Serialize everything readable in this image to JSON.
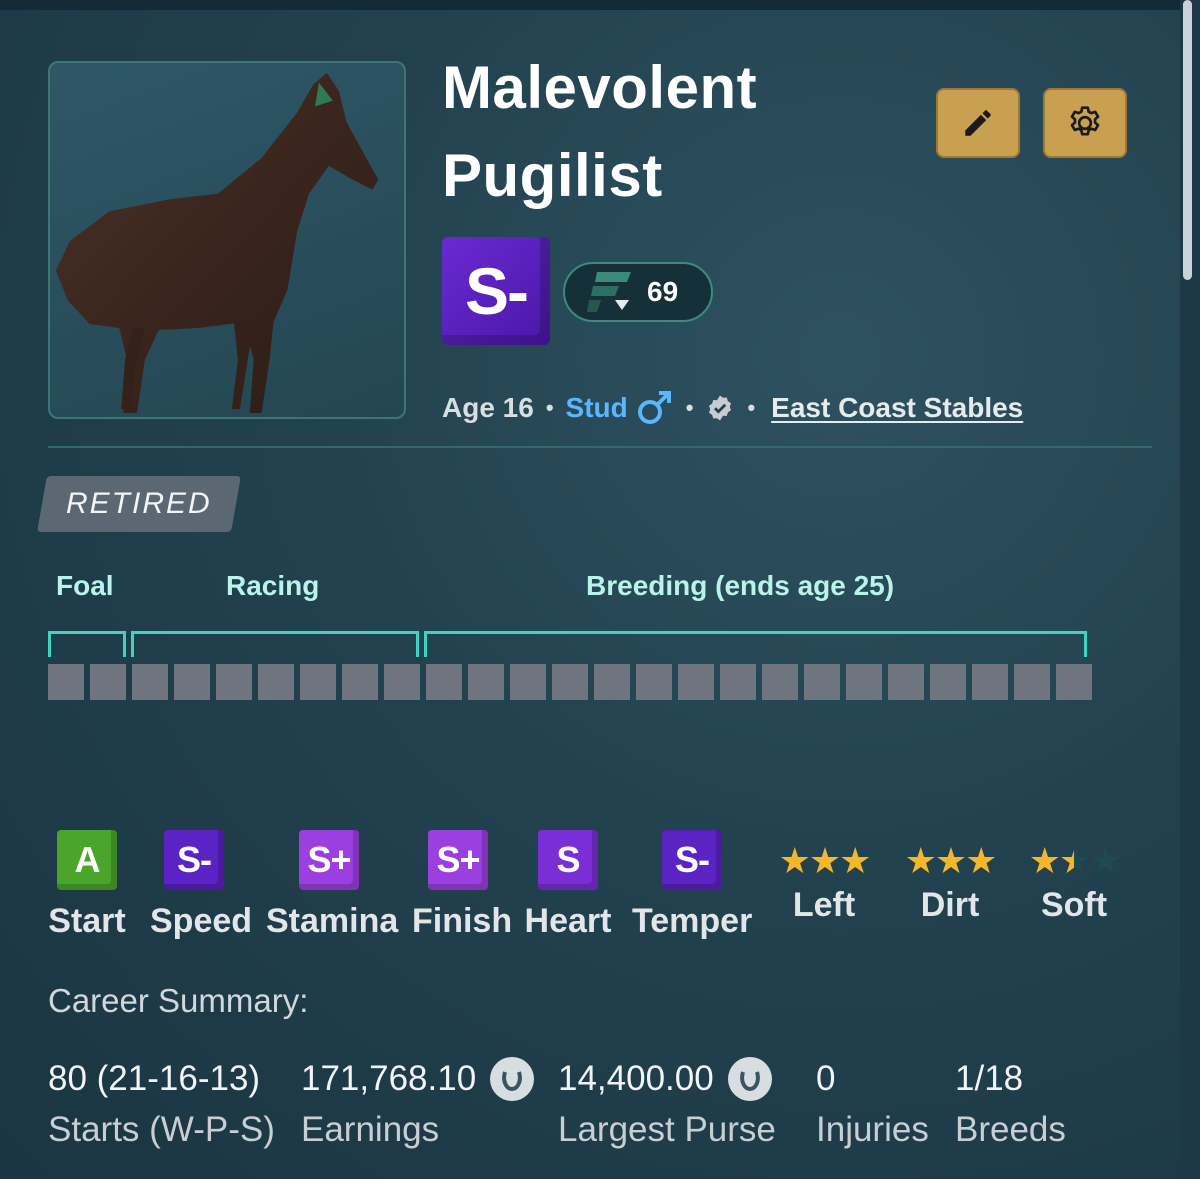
{
  "horse": {
    "name_line1": "Malevolent",
    "name_line2": "Pugilist",
    "overall_grade": "S-",
    "rating": "69",
    "age": "Age 16",
    "sex": "Stud",
    "stable": "East Coast Stables",
    "status": "RETIRED"
  },
  "lifecycle": {
    "phases": [
      {
        "label": "Foal"
      },
      {
        "label": "Racing"
      },
      {
        "label": "Breeding (ends age 25)"
      }
    ],
    "ages_completed": 25,
    "ages_total": 25
  },
  "attributes": [
    {
      "label": "Start",
      "grade": "A",
      "color": "#4aa52a"
    },
    {
      "label": "Speed",
      "grade": "S-",
      "color": "#5b22c4"
    },
    {
      "label": "Stamina",
      "grade": "S+",
      "color": "#9b3fe0"
    },
    {
      "label": "Finish",
      "grade": "S+",
      "color": "#9b3fe0"
    },
    {
      "label": "Heart",
      "grade": "S",
      "color": "#7a2fd6"
    },
    {
      "label": "Temper",
      "grade": "S-",
      "color": "#5b22c4"
    }
  ],
  "preferences": [
    {
      "label": "Left",
      "stars": 3
    },
    {
      "label": "Dirt",
      "stars": 3
    },
    {
      "label": "Soft",
      "stars": 1.5
    }
  ],
  "career": {
    "title": "Career Summary:",
    "items": [
      {
        "value": "80 (21-16-13)",
        "label": "Starts (W-P-S)"
      },
      {
        "value": "171,768.10",
        "label": "Earnings",
        "coin": true
      },
      {
        "value": "14,400.00",
        "label": "Largest Purse",
        "coin": true
      },
      {
        "value": "0",
        "label": "Injuries"
      },
      {
        "value": "1/18",
        "label": "Breeds"
      }
    ]
  },
  "colors": {
    "accent_teal": "#3fd3c4",
    "button_gold": "#c9a04f",
    "stud_blue": "#58b7ff",
    "star_gold": "#f5b72a"
  },
  "icons": [
    "pencil-icon",
    "gear-icon",
    "rating-logo-icon",
    "male-symbol-icon",
    "verified-badge-icon",
    "coin-icon",
    "star-icon"
  ]
}
